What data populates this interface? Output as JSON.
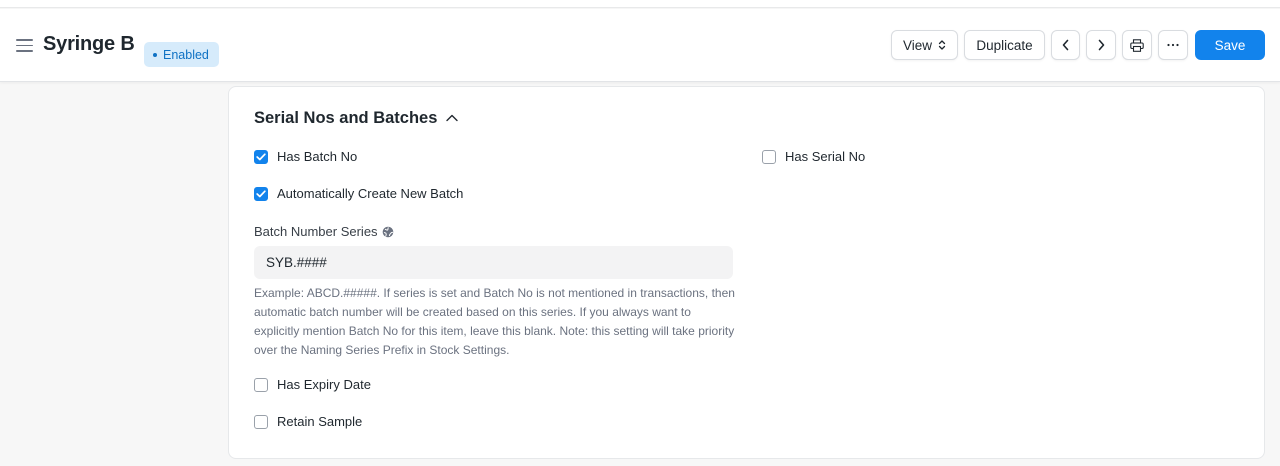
{
  "header": {
    "title": "Syringe B",
    "status": "Enabled",
    "buttons": {
      "view": "View",
      "duplicate": "Duplicate",
      "save": "Save"
    },
    "icons": [
      "menu-icon",
      "chevron-up-down-icon",
      "chevron-left-icon",
      "chevron-right-icon",
      "printer-icon",
      "more-icon"
    ]
  },
  "section": {
    "title": "Serial Nos and Batches",
    "fields": {
      "has_batch_no": {
        "label": "Has Batch No",
        "checked": true
      },
      "has_serial_no": {
        "label": "Has Serial No",
        "checked": false
      },
      "auto_create_batch": {
        "label": "Automatically Create New Batch",
        "checked": true
      },
      "batch_number_series": {
        "label": "Batch Number Series",
        "value": "SYB.####",
        "help": "Example: ABCD.#####. If series is set and Batch No is not mentioned in transactions, then automatic batch number will be created based on this series. If you always want to explicitly mention Batch No for this item, leave this blank. Note: this setting will take priority over the Naming Series Prefix in Stock Settings."
      },
      "has_expiry_date": {
        "label": "Has Expiry Date",
        "checked": false
      },
      "retain_sample": {
        "label": "Retain Sample",
        "checked": false
      }
    }
  },
  "colors": {
    "primary": "#1283ec",
    "badge_bg": "#d6ebfb",
    "badge_text": "#0f72c4"
  }
}
